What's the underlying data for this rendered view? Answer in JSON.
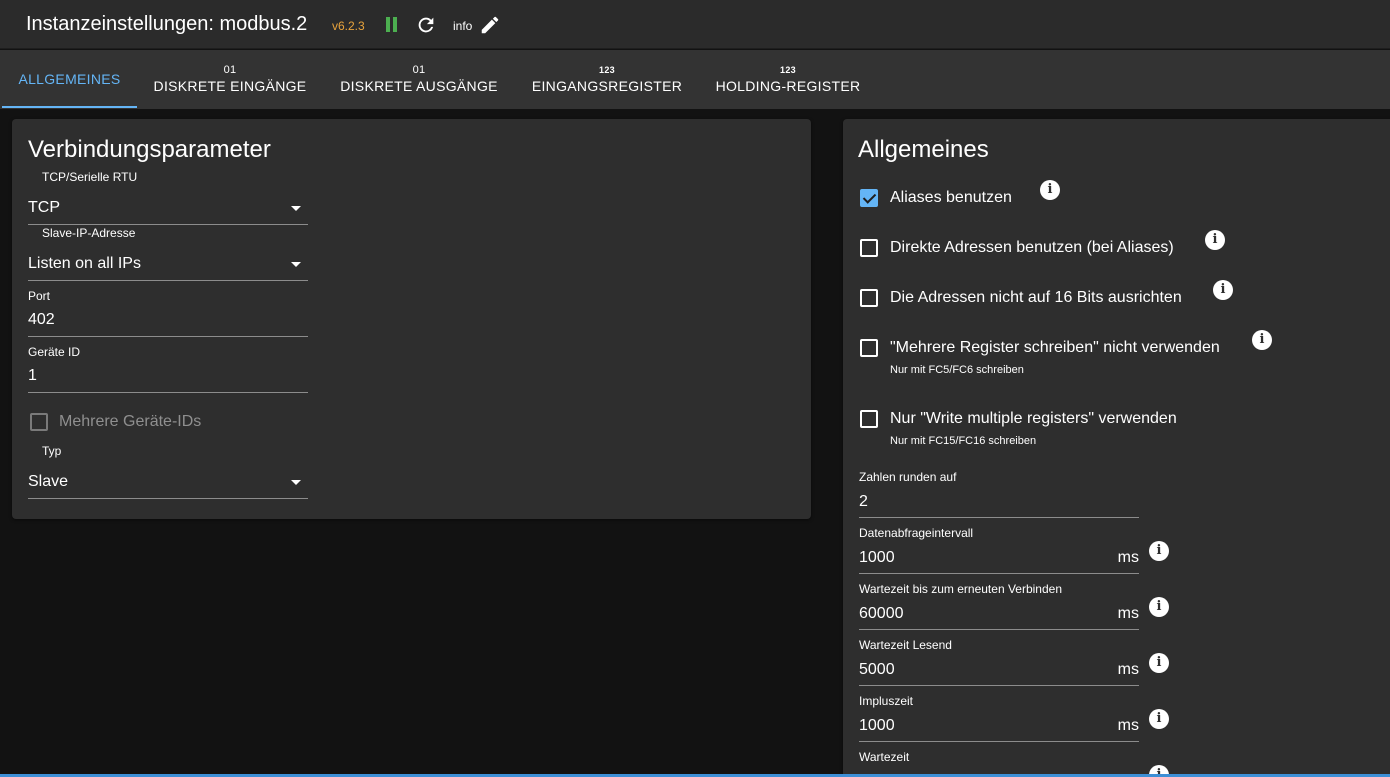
{
  "header": {
    "title": "Instanzeinstellungen: modbus.2",
    "version": "v6.2.3",
    "info_label": "info"
  },
  "tabs": [
    {
      "sub": "",
      "label": "Allgemeines",
      "active": true
    },
    {
      "sub": "01",
      "label": "Diskrete Eingänge"
    },
    {
      "sub": "01",
      "label": "Diskrete Ausgänge"
    },
    {
      "sub": "123",
      "label": "Eingangsregister"
    },
    {
      "sub": "123",
      "label": "Holding-Register"
    }
  ],
  "connection": {
    "title": "Verbindungsparameter",
    "mode": {
      "label": "TCP/Serielle RTU",
      "value": "TCP"
    },
    "slave_ip": {
      "label": "Slave-IP-Adresse",
      "value": "Listen on all IPs"
    },
    "port": {
      "label": "Port",
      "value": "402"
    },
    "device_id": {
      "label": "Geräte ID",
      "value": "1"
    },
    "multi_ids": {
      "label": "Mehrere Geräte-IDs",
      "checked": false
    },
    "type": {
      "label": "Typ",
      "value": "Slave"
    }
  },
  "general": {
    "title": "Allgemeines",
    "options": [
      {
        "label": "Aliases benutzen",
        "checked": true,
        "help": ""
      },
      {
        "label": "Direkte Adressen benutzen (bei Aliases)",
        "checked": false,
        "help": ""
      },
      {
        "label": "Die Adressen nicht auf 16 Bits ausrichten",
        "checked": false,
        "help": ""
      },
      {
        "label": "\"Mehrere Register schreiben\" nicht verwenden",
        "checked": false,
        "help": "Nur mit FC5/FC6 schreiben"
      },
      {
        "label": "Nur \"Write multiple registers\" verwenden",
        "checked": false,
        "help": "Nur mit FC15/FC16 schreiben"
      }
    ],
    "round": {
      "label": "Zahlen runden auf",
      "value": "2"
    },
    "poll": {
      "label": "Datenabfrageintervall",
      "value": "1000",
      "unit": "ms"
    },
    "reconnect": {
      "label": "Wartezeit bis zum erneuten Verbinden",
      "value": "60000",
      "unit": "ms"
    },
    "read_timeout": {
      "label": "Wartezeit Lesend",
      "value": "5000",
      "unit": "ms"
    },
    "pulse": {
      "label": "Impluszeit",
      "value": "1000",
      "unit": "ms"
    },
    "wait": {
      "label": "Wartezeit"
    }
  },
  "colors": {
    "accent": "#64b5f6",
    "version": "#e8a33c",
    "pause": "#4caf50"
  },
  "icons": [
    "pause-icon",
    "refresh-icon",
    "edit-icon",
    "info-icon",
    "dropdown-caret-icon",
    "checkbox-icon"
  ]
}
